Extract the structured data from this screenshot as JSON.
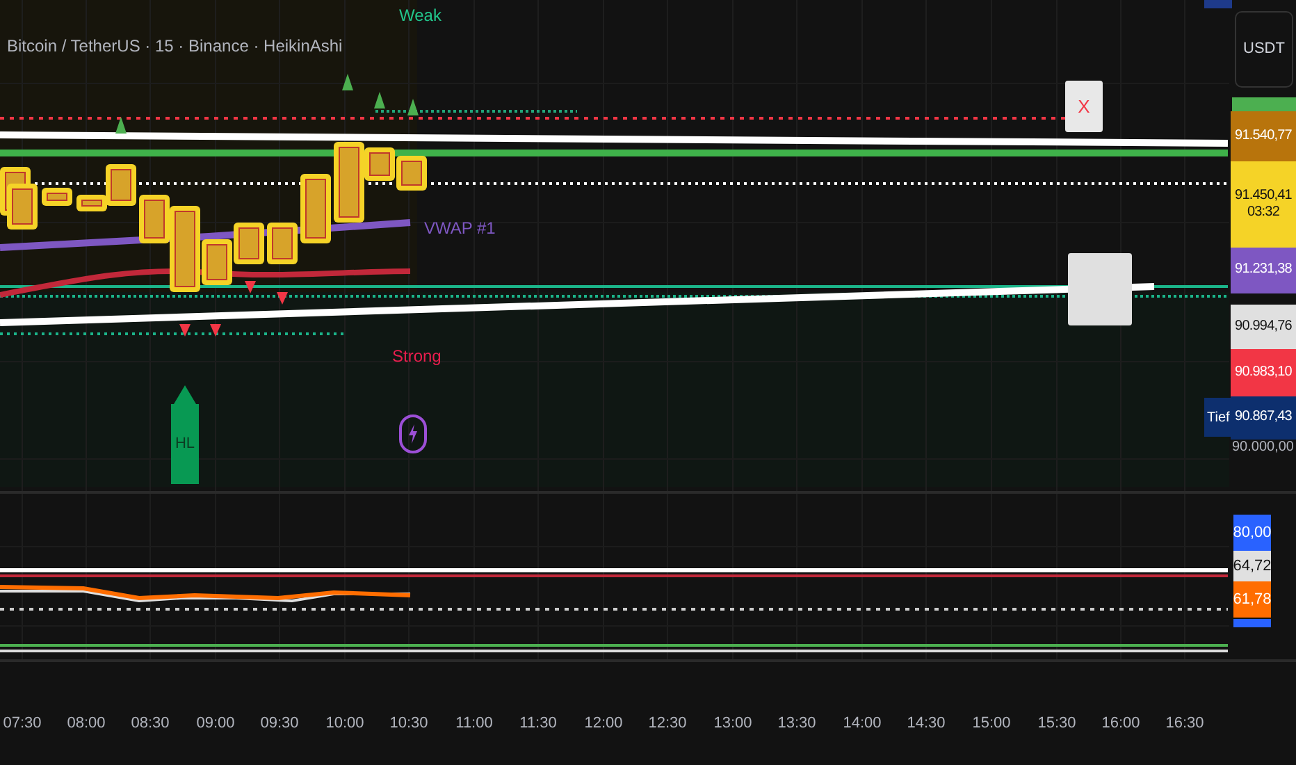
{
  "chart": {
    "title": "Bitcoin / TetherUS · 15 · Binance · HeikinAshi",
    "annotations": [
      {
        "kind": "text",
        "text": "Weak",
        "color": "#22c58b"
      },
      {
        "kind": "text",
        "text": "VWAP #1",
        "color": "#7e57c2"
      },
      {
        "kind": "text",
        "text": "Strong",
        "color": "#e91e4e"
      },
      {
        "kind": "flag",
        "text": "HL",
        "color": "#089953"
      },
      {
        "kind": "tag",
        "text": "X",
        "color": "#f23645"
      }
    ]
  },
  "price_axis": {
    "currency_button": "USDT",
    "labels": [
      {
        "text": "91.540,77",
        "color": "#b8740c"
      },
      {
        "text": "91.450,41",
        "sub": "03:32",
        "color": "#f5d327"
      },
      {
        "text": "91.231,38",
        "color": "#7e57c2"
      },
      {
        "text": "90.994,76",
        "color": "#e0e0e0"
      },
      {
        "text": "90.983,10",
        "color": "#f23645"
      },
      {
        "text": "90.867,43",
        "color": "#0d2f6e",
        "tag": "Tief"
      }
    ],
    "ticks": [
      "90.000,00"
    ]
  },
  "oscillator": {
    "labels": [
      {
        "text": "80,00",
        "color": "#2962ff"
      },
      {
        "text": "64,72",
        "color": "#e0e0e0"
      },
      {
        "text": "61,78",
        "color": "#ff6d00"
      }
    ]
  },
  "time_axis": [
    "07:30",
    "08:00",
    "08:30",
    "09:00",
    "09:30",
    "10:00",
    "10:30",
    "11:00",
    "11:30",
    "12:00",
    "12:30",
    "13:00",
    "13:30",
    "14:00",
    "14:30",
    "15:00",
    "15:30",
    "16:00",
    "16:30"
  ]
}
